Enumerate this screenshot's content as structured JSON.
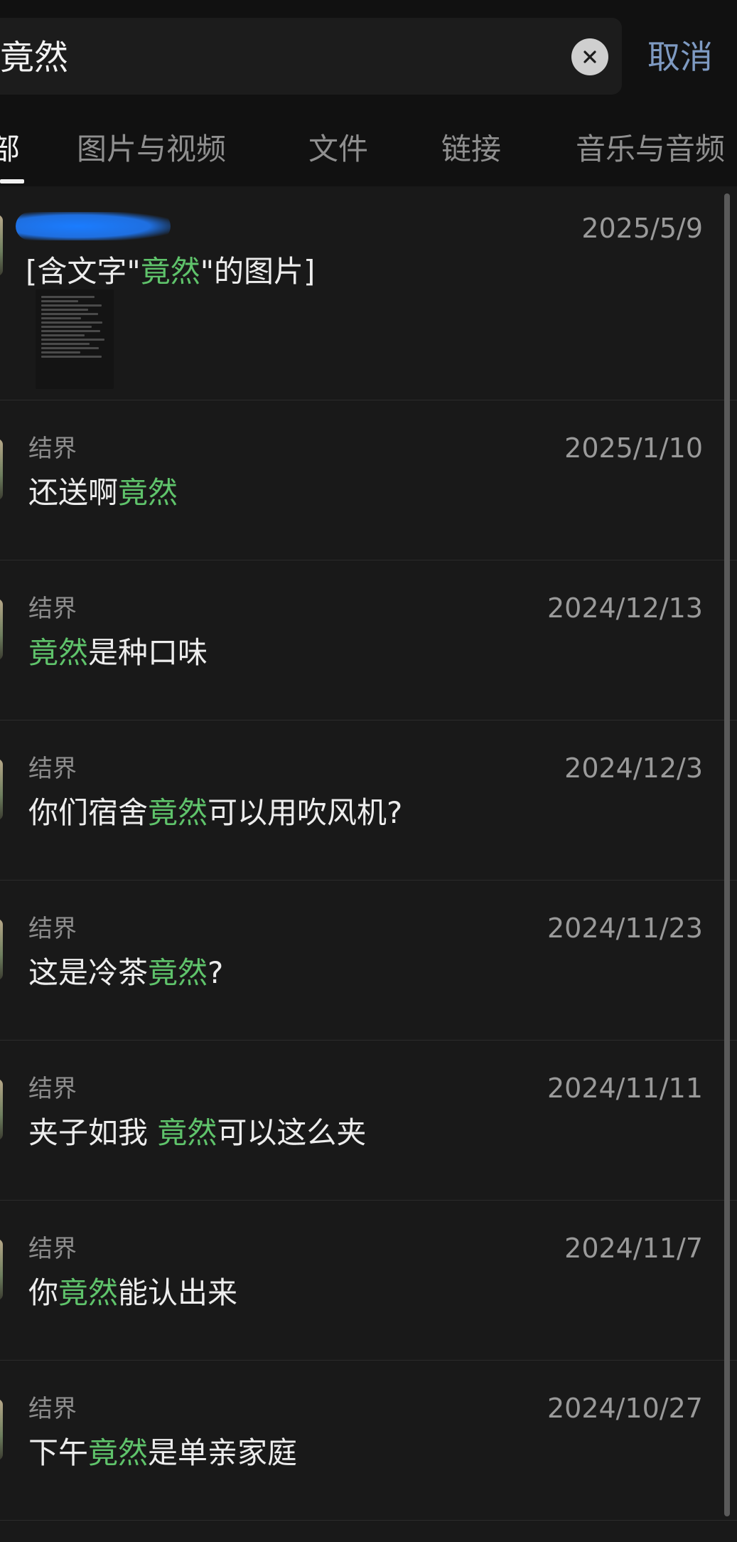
{
  "search": {
    "query": "竟然",
    "cancel_label": "取消"
  },
  "tabs": [
    {
      "label": "部",
      "active": true
    },
    {
      "label": "图片与视频"
    },
    {
      "label": "文件"
    },
    {
      "label": "链接"
    },
    {
      "label": "音乐与音频"
    }
  ],
  "results": [
    {
      "type": "image",
      "date": "2025/5/9",
      "message_prefix": "[含文字\"",
      "message_highlight": "竟然",
      "message_suffix": "\"的图片]"
    },
    {
      "sender": "结界",
      "date": "2025/1/10",
      "pre": "还送啊",
      "hl": "竟然",
      "post": ""
    },
    {
      "sender": "结界",
      "date": "2024/12/13",
      "pre": "",
      "hl": "竟然",
      "post": "是种口味"
    },
    {
      "sender": "结界",
      "date": "2024/12/3",
      "pre": "你们宿舍",
      "hl": "竟然",
      "post": "可以用吹风机?"
    },
    {
      "sender": "结界",
      "date": "2024/11/23",
      "pre": "这是冷茶",
      "hl": "竟然",
      "post": "?"
    },
    {
      "sender": "结界",
      "date": "2024/11/11",
      "pre": "夹子如我 ",
      "hl": "竟然",
      "post": "可以这么夹"
    },
    {
      "sender": "结界",
      "date": "2024/11/7",
      "pre": "你",
      "hl": "竟然",
      "post": "能认出来"
    },
    {
      "sender": "结界",
      "date": "2024/10/27",
      "pre": "下午",
      "hl": "竟然",
      "post": "是单亲家庭"
    }
  ],
  "colors": {
    "background": "#191919",
    "header_background": "#111111",
    "highlight": "#5fc36b",
    "cancel": "#7e9ac2",
    "secondary_text": "#8d8d8d"
  },
  "icons": {
    "clear": "close-circle-icon"
  }
}
